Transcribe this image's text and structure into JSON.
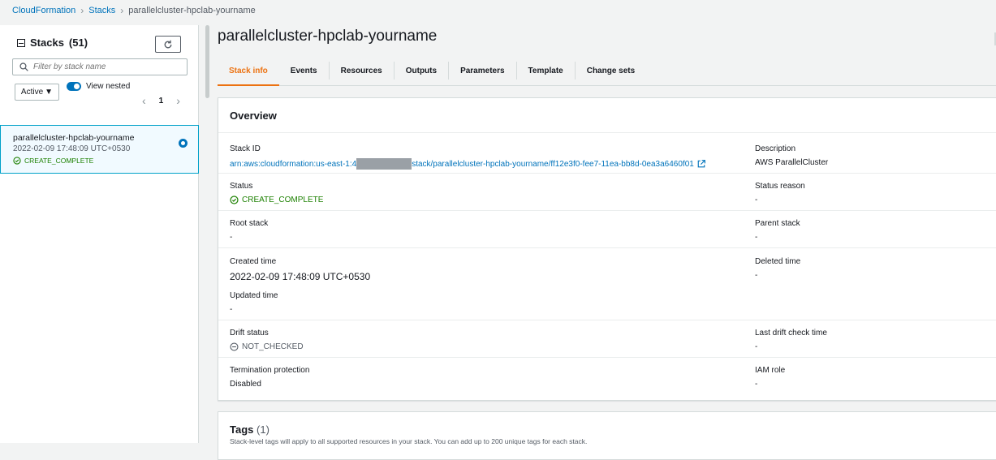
{
  "breadcrumb": {
    "items": [
      "CloudFormation",
      "Stacks",
      "parallelcluster-hpclab-yourname"
    ]
  },
  "sidebar": {
    "title": "Stacks",
    "count": "(51)",
    "search_placeholder": "Filter by stack name",
    "filter_value": "Active",
    "view_nested_label": "View nested",
    "page": "1",
    "selected_stack": {
      "name": "parallelcluster-hpclab-yourname",
      "time": "2022-02-09 17:48:09 UTC+0530",
      "status": "CREATE_COMPLETE"
    }
  },
  "main": {
    "title": "parallelcluster-hpclab-yourname",
    "tabs": [
      "Stack info",
      "Events",
      "Resources",
      "Outputs",
      "Parameters",
      "Template",
      "Change sets"
    ],
    "active_tab": "Stack info"
  },
  "overview": {
    "title": "Overview",
    "stack_id_label": "Stack ID",
    "stack_id_prefix": "arn:aws:cloudformation:us-east-1:4",
    "stack_id_suffix": "stack/parallelcluster-hpclab-yourname/ff12e3f0-fee7-11ea-bb8d-0ea3a6460f01",
    "description_label": "Description",
    "description_value": "AWS ParallelCluster",
    "status_label": "Status",
    "status_value": "CREATE_COMPLETE",
    "status_reason_label": "Status reason",
    "status_reason_value": "-",
    "root_stack_label": "Root stack",
    "root_stack_value": "-",
    "parent_stack_label": "Parent stack",
    "parent_stack_value": "-",
    "created_time_label": "Created time",
    "created_time_value": "2022-02-09 17:48:09 UTC+0530",
    "deleted_time_label": "Deleted time",
    "deleted_time_value": "-",
    "updated_time_label": "Updated time",
    "updated_time_value": "-",
    "drift_status_label": "Drift status",
    "drift_status_value": "NOT_CHECKED",
    "last_drift_label": "Last drift check time",
    "last_drift_value": "-",
    "termination_label": "Termination protection",
    "termination_value": "Disabled",
    "iam_role_label": "IAM role",
    "iam_role_value": "-"
  },
  "tags": {
    "title": "Tags",
    "count": "(1)",
    "description": "Stack-level tags will apply to all supported resources in your stack. You can add up to 200 unique tags for each stack."
  },
  "colors": {
    "link": "#0073bb",
    "accent": "#ec7211",
    "success": "#1d8102"
  }
}
